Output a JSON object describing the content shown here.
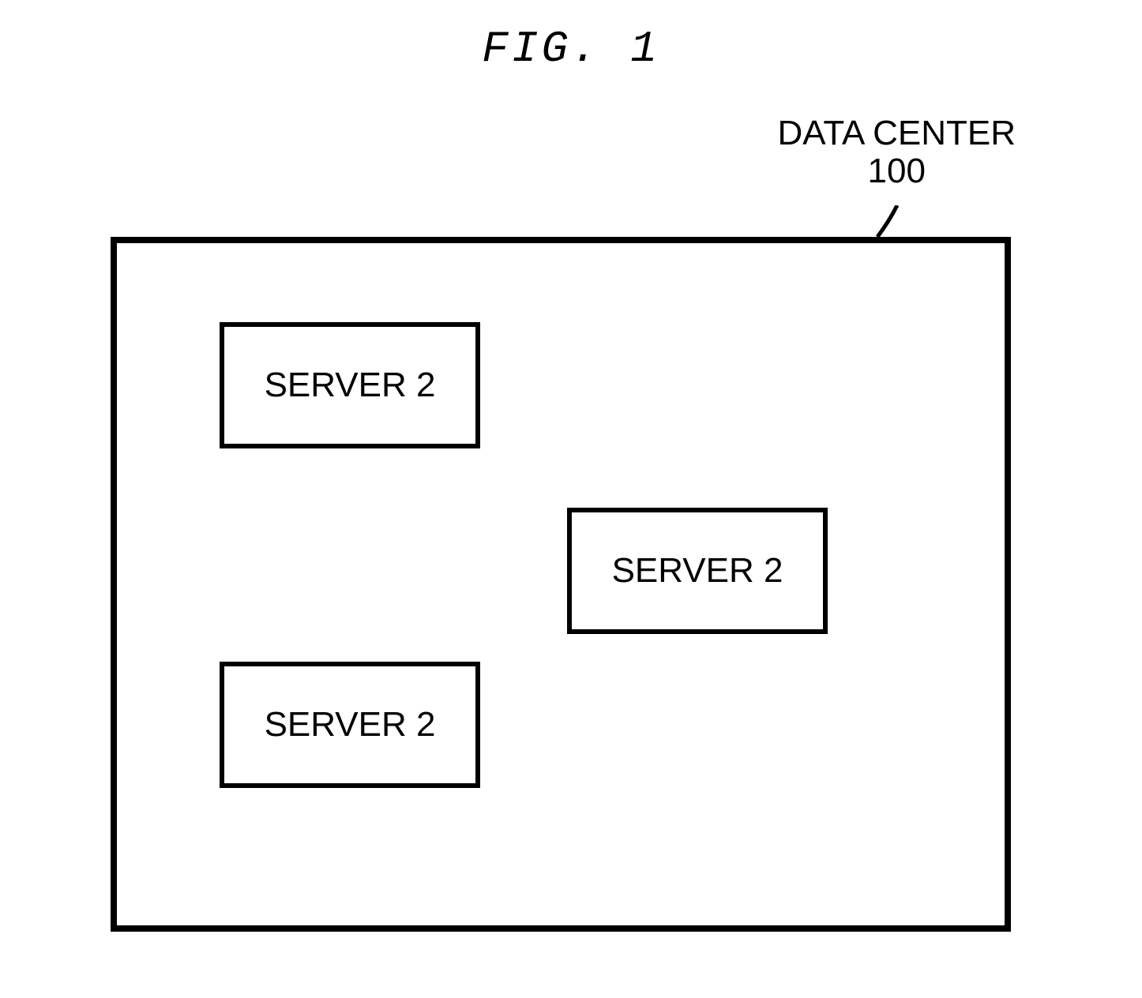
{
  "figure": {
    "title": "FIG. 1"
  },
  "container": {
    "label_line1": "DATA CENTER",
    "label_line2": "100"
  },
  "servers": [
    {
      "label": "SERVER 2"
    },
    {
      "label": "SERVER 2"
    },
    {
      "label": "SERVER 2"
    }
  ]
}
